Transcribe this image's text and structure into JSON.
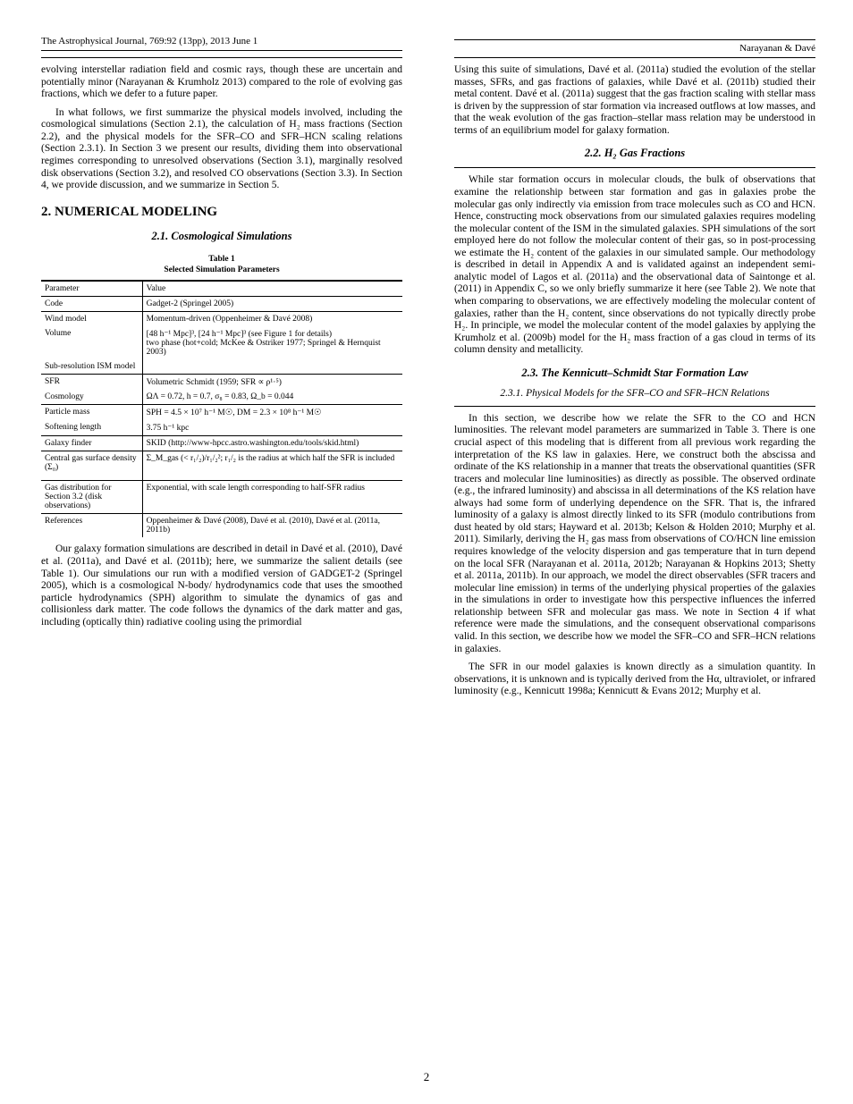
{
  "running_header": {
    "left": {
      "top": "The Astrophysical Journal, 769:92 (13pp), 2013 June 1",
      "bottom": ""
    },
    "right": {
      "top": "",
      "bottom_right": "Narayanan & Davé"
    }
  },
  "left_col": {
    "para1": "evolving interstellar radiation field and cosmic rays, though these are uncertain and potentially minor (Narayanan & Krumholz 2013) compared to the role of evolving gas fractions, which we defer to a future paper.",
    "para2": "In what follows, we first summarize the physical models involved, including the cosmological simulations (Section 2.1), the calculation of H₂ mass fractions (Section 2.2), and the physical models for the SFR–CO and SFR–HCN scaling relations (Section 2.3.1). In Section 3 we present our results, dividing them into observational regimes corresponding to unresolved observations (Section 3.1), marginally resolved disk observations (Section 3.2), and resolved CO observations (Section 3.3). In Section 4, we provide discussion, and we summarize in Section 5.",
    "sec_title": "2. NUMERICAL MODELING",
    "sub_title": "2.1. Cosmological Simulations",
    "table_caption": "Table 1\nSelected Simulation Parameters",
    "table": {
      "col1_header": "Parameter",
      "col2_header": "Value",
      "rows": [
        [
          "Code",
          "Gadget-2 (Springel 2005)"
        ],
        [
          "Wind model",
          "Momentum-driven (Oppenheimer & Davé 2008)"
        ],
        [
          "Volume",
          "[48 h⁻¹ Mpc]³, [24 h⁻¹ Mpc]³ (see Figure 1 for details)\ntwo phase (hot+cold; McKee & Ostriker 1977; Springel & Hernquist 2003)"
        ],
        [
          "Sub-resolution ISM model",
          ""
        ],
        [
          "SFR",
          "Volumetric Schmidt (1959; SFR ∝ ρ¹·⁵)"
        ],
        [
          "Cosmology",
          "ΩΛ = 0.72, h = 0.7, σ₈ = 0.83, Ω_b = 0.044"
        ],
        [
          "Particle mass",
          "SPH = 4.5 × 10⁷ h⁻¹ M☉, DM = 2.3 × 10⁸ h⁻¹ M☉"
        ],
        [
          "Softening length",
          "3.75 h⁻¹ kpc"
        ],
        [
          "Galaxy finder",
          "SKID (http://www-hpcc.astro.washington.edu/tools/skid.html)"
        ],
        [
          "Central gas surface density (Σ₀)",
          "Σ_M_gas (< r₁/₂)/r₁/₂²; r₁/₂ is the radius at which half the SFR is included"
        ],
        [
          "Gas distribution for Section 3.2 (disk observations)",
          "Exponential, with scale length corresponding to half-SFR radius"
        ],
        [
          "References",
          "Oppenheimer & Davé (2008), Davé et al. (2010), Davé et al. (2011a, 2011b)"
        ]
      ]
    }
  },
  "right_col": {
    "blocks": [
      {
        "type": "hdr"
      },
      {
        "type": "p",
        "text": "Using this suite of simulations, Davé et al. (2011a) studied the evolution of the stellar masses, SFRs, and gas fractions of galaxies, while Davé et al. (2011b) studied their metal content. Davé et al. (2011a) suggest that the gas fraction scaling with stellar mass is driven by the suppression of star formation via increased outflows at low masses, and that the weak evolution of the gas fraction–stellar mass relation may be understood in terms of an equilibrium model for galaxy formation."
      },
      {
        "type": "h3",
        "text": "2.2. H₂ Gas Fractions"
      },
      {
        "type": "rule"
      },
      {
        "type": "p",
        "text": "While star formation occurs in molecular clouds, the bulk of observations that examine the relationship between star formation and gas in galaxies probe the molecular gas only indirectly via emission from trace molecules such as CO and HCN. Hence, constructing mock observations from our simulated galaxies requires modeling the molecular content of the ISM in the simulated galaxies. SPH simulations of the sort employed here do not follow the molecular content of their gas, so in post-processing we estimate the H₂ content of the galaxies in our simulated sample. Our methodology is described in detail in Appendix A and is validated against an independent semi-analytic model of Lagos et al. (2011a) and the observational data of Saintonge et al. (2011) in Appendix C, so we only briefly summarize it here (see Table 2). We note that when comparing to observations, we are effectively modeling the molecular content of galaxies, rather than the H₂ content, since observations do not typically directly probe H₂. In principle, we model the molecular content of the model galaxies by applying the Krumholz et al. (2009b) model for the H₂ mass fraction of a gas cloud in terms of its column density and metallicity."
      },
      {
        "type": "h3",
        "text": "2.3. The Kennicutt–Schmidt Star Formation Law"
      },
      {
        "type": "mini",
        "text": "2.3.1. Physical Models for the SFR–CO and SFR–HCN Relations"
      },
      {
        "type": "rule"
      },
      {
        "type": "p",
        "text": "In this section, we describe how we relate the SFR to the CO and HCN luminosities. The relevant model parameters are summarized in Table 3. There is one crucial aspect of this modeling that is different from all previous work regarding the interpretation of the KS law in galaxies. Here, we construct both the abscissa and ordinate of the KS relationship in a manner that treats the observational quantities (SFR tracers and molecular line luminosities) as directly as possible. The observed ordinate (e.g., the infrared luminosity) and abscissa in all determinations of the KS relation have always had some form of underlying dependence on the SFR. That is, the infrared luminosity of a galaxy is almost directly linked to its SFR (modulo contributions from dust heated by old stars; Hayward et al. 2013b; Kelson & Holden 2010; Murphy et al. 2011). Similarly, deriving the H₂ gas mass from observations of CO/HCN line emission requires knowledge of the velocity dispersion and gas temperature that in turn depend on the local SFR (Narayanan et al. 2011a, 2012b; Narayanan & Hopkins 2013; Shetty et al. 2011a, 2011b). In our approach, we model the direct observables (SFR tracers and molecular line emission) in terms of the underlying physical properties of the galaxies in the simulations in order to investigate how this perspective influences the inferred relationship between SFR and molecular gas mass. We note in Section 4 if what reference were made the simulations, and the consequent observational comparisons valid. In this section, we describe how we model the SFR–CO and SFR–HCN relations in galaxies."
      },
      {
        "type": "p",
        "text": "The SFR in our model galaxies is known directly as a simulation quantity. In observations, it is unknown and is typically derived from the Hα, ultraviolet, or infrared luminosity (e.g., Kennicutt 1998a; Kennicutt & Evans 2012; Murphy et al."
      }
    ],
    "left_body": [
      "Our galaxy formation simulations are described in detail in Davé et al. (2010), Davé et al. (2011a), and Davé et al. (2011b); here, we summarize the salient details (see Table 1). Our simulations our run with a modified version of GADGET-2 (Springel 2005), which is a cosmological N-body/ hydrodynamics code that uses the smoothed particle hydrodynamics (SPH) algorithm to simulate the dynamics of gas and collisionless dark matter. The code follows the dynamics of the dark matter and gas, including (optically thin) radiative cooling using the primordial"
    ]
  },
  "footer": {
    "page": "2"
  }
}
